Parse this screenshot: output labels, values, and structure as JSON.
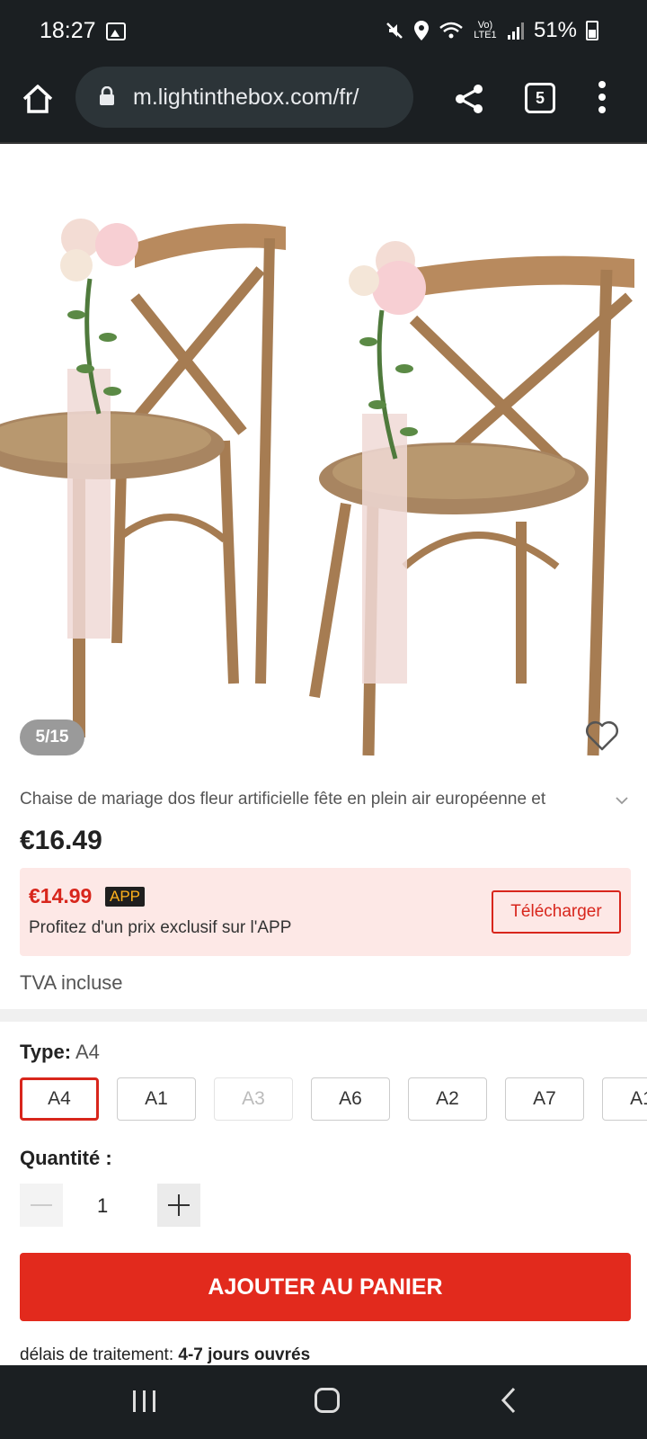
{
  "status": {
    "time": "18:27",
    "signal": "Vo) LTE1",
    "battery": "51%"
  },
  "browser": {
    "url": "m.lightinthebox.com/fr/",
    "tab_count": "5"
  },
  "gallery": {
    "counter": "5/15"
  },
  "product": {
    "title": "Chaise de mariage dos fleur artificielle fête en plein air européenne et",
    "price": "€16.49",
    "app_price": "€14.99",
    "app_badge": "APP",
    "app_desc": "Profitez d'un prix exclusif sur l'APP",
    "download_label": "Télécharger",
    "tva": "TVA incluse"
  },
  "type": {
    "label": "Type:",
    "selected": "A4",
    "options": [
      {
        "label": "A4",
        "state": "selected"
      },
      {
        "label": "A1",
        "state": "normal"
      },
      {
        "label": "A3",
        "state": "disabled"
      },
      {
        "label": "A6",
        "state": "normal"
      },
      {
        "label": "A2",
        "state": "normal"
      },
      {
        "label": "A7",
        "state": "normal"
      },
      {
        "label": "A1",
        "state": "normal"
      }
    ]
  },
  "quantity": {
    "label": "Quantité :",
    "value": "1"
  },
  "cart": {
    "add_label": "AJOUTER AU PANIER"
  },
  "processing": {
    "label": "délais de traitement:",
    "value": "4-7 jours ouvrés"
  },
  "colors": {
    "accent": "#e22a1d",
    "banner_bg": "#fde8e6",
    "system_bar": "#1b1f22"
  }
}
